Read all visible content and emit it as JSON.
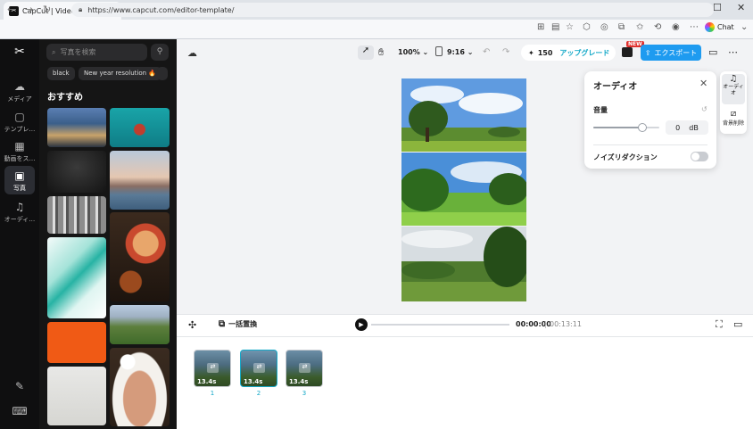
{
  "browser": {
    "tab_title": "CapCut | Video Editor | All-In-One",
    "url": "https://www.capcut.com/editor-template/",
    "chat_label": "Chat",
    "new_tab": "+",
    "win_min": "—",
    "win_max": "☐",
    "win_close": "✕"
  },
  "rail": {
    "items": [
      {
        "label": "メディア",
        "icon": "cloud-upload-icon"
      },
      {
        "label": "テンプレ…",
        "icon": "template-icon"
      },
      {
        "label": "動画をス…",
        "icon": "film-icon"
      },
      {
        "label": "写真",
        "icon": "photo-icon"
      },
      {
        "label": "オーディ…",
        "icon": "music-note-icon"
      }
    ]
  },
  "panel": {
    "search_placeholder": "写真を検索",
    "chips": [
      "black",
      "New year resolution 🔥"
    ],
    "section_title": "おすすめ"
  },
  "toolbar": {
    "zoom": "100%",
    "ratio": "9:16",
    "credits": "150",
    "upgrade_label": "アップグレード",
    "new_badge": "NEW",
    "export_label": "エクスポート"
  },
  "audio_panel": {
    "title": "オーディオ",
    "volume_label": "音量",
    "volume_value": "0",
    "volume_unit": "dB",
    "volume_level": 0.74,
    "noise_label": "ノイズリダクション",
    "noise_on": false
  },
  "side_tabs": [
    {
      "label": "オーディオ",
      "icon": "music-note-icon"
    },
    {
      "label": "背景削除",
      "icon": "remove-bg-icon"
    }
  ],
  "playbar": {
    "replace_label": "一括置換",
    "current_time": "00:00:00",
    "separator": "|",
    "total_time": "00:13:11"
  },
  "timeline": {
    "clips": [
      {
        "duration": "13.4s",
        "number": "1"
      },
      {
        "duration": "13.4s",
        "number": "2"
      },
      {
        "duration": "13.4s",
        "number": "3"
      }
    ]
  },
  "colors": {
    "accent": "#15a9c8",
    "export": "#1e9bf0",
    "rail_bg": "#0f0f10",
    "panel_bg": "#151515"
  }
}
